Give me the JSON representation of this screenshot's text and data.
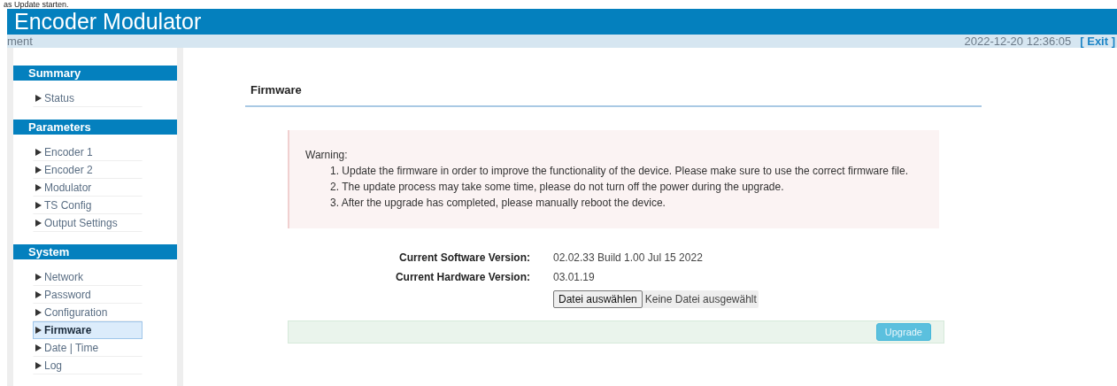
{
  "page_caption": "as Update starten.",
  "header": {
    "title": "Encoder Modulator"
  },
  "subbar": {
    "breadcrumb": "ment",
    "datetime": "2022-12-20 12:36:05",
    "exit_link": "[ Exit ]"
  },
  "sidebar": {
    "sections": [
      {
        "title": "Summary",
        "items": [
          {
            "label": "Status",
            "selected": false
          }
        ]
      },
      {
        "title": "Parameters",
        "items": [
          {
            "label": "Encoder 1",
            "selected": false
          },
          {
            "label": "Encoder 2",
            "selected": false
          },
          {
            "label": "Modulator",
            "selected": false
          },
          {
            "label": "TS Config",
            "selected": false
          },
          {
            "label": "Output Settings",
            "selected": false
          }
        ]
      },
      {
        "title": "System",
        "items": [
          {
            "label": "Network",
            "selected": false
          },
          {
            "label": "Password",
            "selected": false
          },
          {
            "label": "Configuration",
            "selected": false
          },
          {
            "label": "Firmware",
            "selected": true
          },
          {
            "label": "Date | Time",
            "selected": false
          },
          {
            "label": "Log",
            "selected": false
          }
        ]
      }
    ]
  },
  "main": {
    "title": "Firmware",
    "warning": {
      "heading": "Warning:",
      "lines": [
        "1. Update the firmware in order to improve the functionality of the device. Please make sure to use the correct firmware file.",
        "2. The update process may take some time, please do not turn off the power during the upgrade.",
        "3. After the upgrade has completed, please manually reboot the device."
      ]
    },
    "fields": [
      {
        "label": "Current Software Version:",
        "value": "02.02.33 Build 1.00 Jul 15 2022"
      },
      {
        "label": "Current Hardware Version:",
        "value": "03.01.19"
      }
    ],
    "file_input": {
      "button": "Datei auswählen",
      "status": "Keine Datei ausgewählt"
    },
    "upgrade_button": "Upgrade"
  }
}
